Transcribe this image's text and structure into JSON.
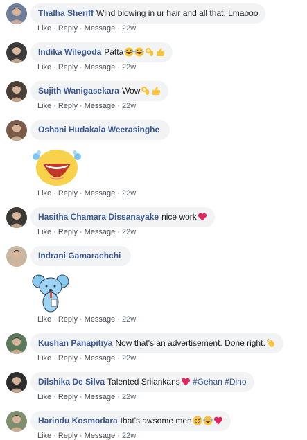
{
  "comments": [
    {
      "author": "Thalha Sheriff",
      "text": "Wind blowing in ur hair and all that. Lmaooo",
      "emojis": [],
      "time": "22w",
      "avatar_color": "#6d7e96"
    },
    {
      "author": "Indika Wilegoda",
      "text": "Patta",
      "emojis": [
        "laugh-cry-emoji",
        "laugh-cry-emoji",
        "ok-hand-emoji",
        "thumbs-up-emoji"
      ],
      "time": "22w",
      "avatar_color": "#3b3b3b"
    },
    {
      "author": "Sujith Wanigasekara",
      "text": "Wow",
      "emojis": [
        "ok-hand-emoji",
        "thumbs-up-emoji"
      ],
      "time": "22w",
      "avatar_color": "#4a4036"
    },
    {
      "author": "Oshani Hudakala Weerasinghe",
      "text": "",
      "emojis": [],
      "sticker": "laughing-face-sticker",
      "time": "22w",
      "avatar_color": "#7a5a48"
    },
    {
      "author": "Hasitha Chamara Dissanayake",
      "text": "nice work",
      "emojis": [
        "red-heart-emoji"
      ],
      "time": "22w",
      "avatar_color": "#3c3a34"
    },
    {
      "author": "Indrani Gamarachchi",
      "text": "",
      "emojis": [],
      "sticker": "blue-koala-sticker",
      "time": "22w",
      "avatar_color": "#c9b6a0"
    },
    {
      "author": "Kushan Panapitiya",
      "text": "Now that's an advertisement. Done right.",
      "emojis": [
        "clapping-hands-emoji"
      ],
      "time": "22w",
      "avatar_color": "#5c7a5a"
    },
    {
      "author": "Dilshika De Silva",
      "text": "Talented Srilankans",
      "emojis": [
        "red-heart-emoji"
      ],
      "hashtags": [
        "#Gehan",
        "#Dino"
      ],
      "time": "22w",
      "avatar_color": "#2e2e2e"
    },
    {
      "author": "Harindu Kosmodara",
      "text": "that's awsome men",
      "emojis": [
        "grinning-sweat-emoji",
        "laugh-cry-emoji",
        "red-heart-emoji"
      ],
      "time": "22w",
      "avatar_color": "#7d8f6c"
    }
  ],
  "actions": {
    "like": "Like",
    "reply": "Reply",
    "message": "Message",
    "separator": "·"
  },
  "colors": {
    "author": "#385898",
    "bubble": "#f2f3f5",
    "meta": "#606770",
    "heart": "#e0245e",
    "emoji_yellow": "#f7c53e"
  }
}
